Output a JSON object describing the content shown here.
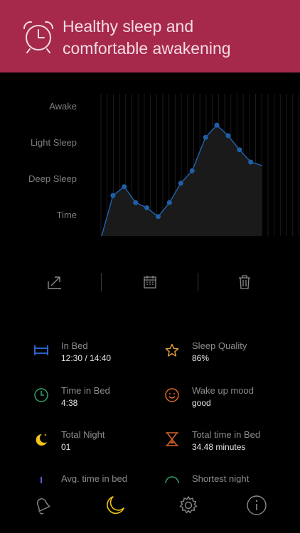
{
  "header": {
    "title": "Healthy sleep and\ncomfortable awakening",
    "icon": "alarm-clock-icon",
    "background_color": "#a6294b"
  },
  "chart_data": {
    "type": "area",
    "y_categories": [
      "Time",
      "Deep Sleep",
      "Light Sleep",
      "Awake"
    ],
    "x": [
      0,
      1,
      2,
      3,
      4,
      5,
      6,
      7,
      8,
      9,
      10,
      11,
      12,
      13,
      14
    ],
    "values": [
      0.0,
      1.15,
      1.4,
      0.95,
      0.8,
      0.55,
      0.95,
      1.5,
      1.85,
      2.8,
      3.15,
      2.85,
      2.45,
      2.1,
      2.0
    ],
    "line_color": "#1f5fa8",
    "marker_color": "#1f5fa8",
    "grid": true,
    "xlabel": "",
    "ylabel": ""
  },
  "toolbar": {
    "items": [
      {
        "name": "share-icon"
      },
      {
        "name": "calendar-icon"
      },
      {
        "name": "trash-icon"
      }
    ]
  },
  "stats": [
    {
      "label": "In Bed",
      "value": "12:30  /  14:40",
      "icon": "bed-icon",
      "color": "#2f6ee0"
    },
    {
      "label": "Sleep Quality",
      "value": "86%",
      "icon": "star-icon",
      "color": "#e8a33a"
    },
    {
      "label": "Time in Bed",
      "value": "4:38",
      "icon": "clock-icon",
      "color": "#2fa36a"
    },
    {
      "label": "Wake up mood",
      "value": "good",
      "icon": "smiley-icon",
      "color": "#e06a2a"
    },
    {
      "label": "Total Night",
      "value": "01",
      "icon": "moon-stars-icon",
      "color": "#f2c418"
    },
    {
      "label": "Total time in Bed",
      "value": "34.48 minutes",
      "icon": "hourglass-icon",
      "color": "#d2622a"
    },
    {
      "label": "Avg. time in bed",
      "value": "",
      "icon": "bar-icon",
      "color": "#5b5bd6"
    },
    {
      "label": "Shortest night",
      "value": "",
      "icon": "circle-icon",
      "color": "#2fa36a"
    }
  ],
  "tabbar": {
    "tabs": [
      {
        "name": "bell-icon",
        "active": false
      },
      {
        "name": "moon-icon",
        "active": true
      },
      {
        "name": "gear-icon",
        "active": false
      },
      {
        "name": "info-icon",
        "active": false
      }
    ],
    "active_color": "#f2c418",
    "inactive_color": "#8a8a8a"
  }
}
